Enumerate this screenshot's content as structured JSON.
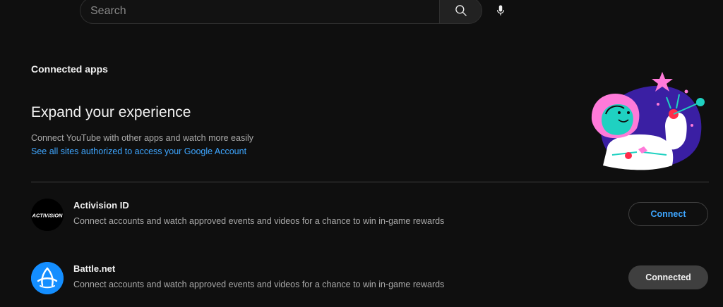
{
  "search": {
    "placeholder": "Search"
  },
  "page": {
    "heading": "Connected apps",
    "hero_title": "Expand your experience",
    "hero_subtitle": "Connect YouTube with other apps and watch more easily",
    "hero_link": "See all sites authorized to access your Google Account"
  },
  "apps": [
    {
      "name": "Activision ID",
      "description": "Connect accounts and watch approved events and videos for a chance to win in-game rewards",
      "logo_text": "ACTIVISION",
      "button_label": "Connect",
      "status": "not-connected"
    },
    {
      "name": "Battle.net",
      "description": "Connect accounts and watch approved events and videos for a chance to win in-game rewards",
      "button_label": "Connected",
      "status": "connected"
    }
  ],
  "colors": {
    "background": "#0f0f0f",
    "link": "#3ea6ff",
    "muted_text": "#aaaaaa",
    "divider": "#3f3f3f",
    "battlenet_blue": "#148eff"
  },
  "icons": {
    "search": "search-icon",
    "mic": "microphone-icon",
    "activision": "activision-logo",
    "battlenet": "battlenet-logo"
  }
}
